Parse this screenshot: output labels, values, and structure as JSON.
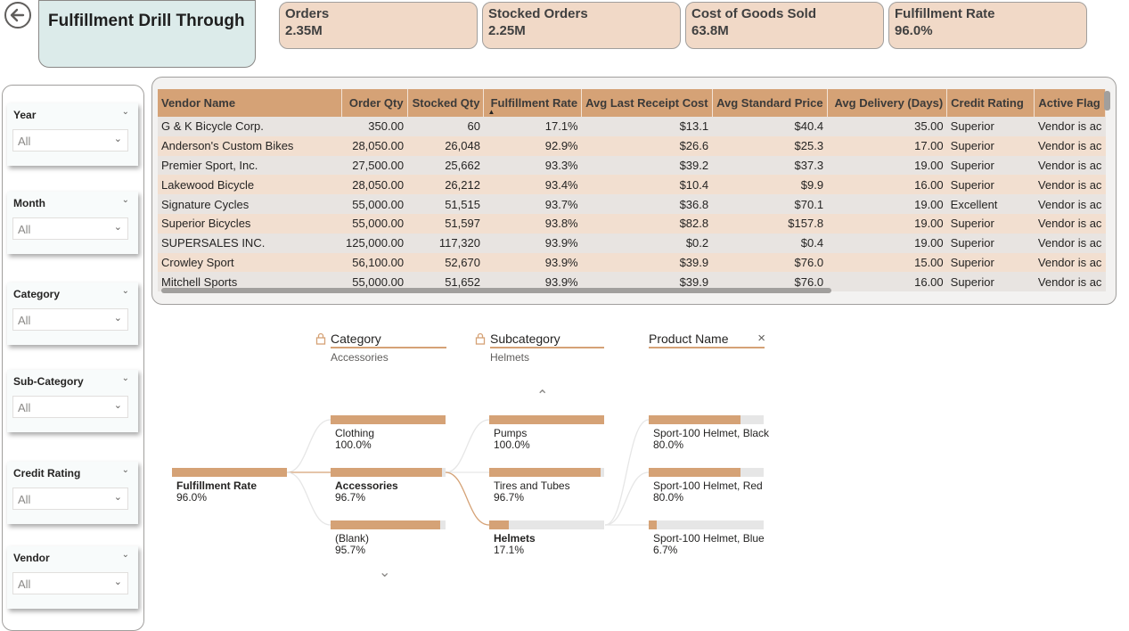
{
  "header": {
    "title": "Fulfillment Drill Through",
    "back_icon": "back-arrow-icon"
  },
  "kpis": [
    {
      "label": "Orders",
      "value": "2.35M"
    },
    {
      "label": "Stocked Orders",
      "value": "2.25M"
    },
    {
      "label": "Cost of Goods Sold",
      "value": "63.8M"
    },
    {
      "label": "Fulfillment Rate",
      "value": "96.0%"
    }
  ],
  "slicers": [
    {
      "title": "Year",
      "value": "All"
    },
    {
      "title": "Month",
      "value": "All"
    },
    {
      "title": "Category",
      "value": "All"
    },
    {
      "title": "Sub-Category",
      "value": "All"
    },
    {
      "title": "Credit Rating",
      "value": "All"
    },
    {
      "title": "Vendor",
      "value": "All"
    }
  ],
  "table": {
    "columns": [
      "Vendor Name",
      "Order Qty",
      "Stocked Qty",
      "Fulfillment Rate",
      "Avg Last Receipt Cost",
      "Avg Standard Price",
      "Avg Delivery (Days)",
      "Credit Rating",
      "Active Flag"
    ],
    "rows": [
      [
        "G & K Bicycle Corp.",
        "350.00",
        "60",
        "17.1%",
        "$13.1",
        "$40.4",
        "35.00",
        "Superior",
        "Vendor is ac"
      ],
      [
        "Anderson's Custom Bikes",
        "28,050.00",
        "26,048",
        "92.9%",
        "$26.6",
        "$25.3",
        "17.00",
        "Superior",
        "Vendor is ac"
      ],
      [
        "Premier Sport, Inc.",
        "27,500.00",
        "25,662",
        "93.3%",
        "$39.2",
        "$37.3",
        "19.00",
        "Superior",
        "Vendor is ac"
      ],
      [
        "Lakewood Bicycle",
        "28,050.00",
        "26,212",
        "93.4%",
        "$10.4",
        "$9.9",
        "16.00",
        "Superior",
        "Vendor is ac"
      ],
      [
        "Signature Cycles",
        "55,000.00",
        "51,515",
        "93.7%",
        "$36.8",
        "$70.1",
        "19.00",
        "Excellent",
        "Vendor is ac"
      ],
      [
        "Superior Bicycles",
        "55,000.00",
        "51,597",
        "93.8%",
        "$82.8",
        "$157.8",
        "19.00",
        "Superior",
        "Vendor is ac"
      ],
      [
        "SUPERSALES INC.",
        "125,000.00",
        "117,320",
        "93.9%",
        "$0.2",
        "$0.4",
        "19.00",
        "Superior",
        "Vendor is ac"
      ],
      [
        "Crowley Sport",
        "56,100.00",
        "52,670",
        "93.9%",
        "$39.9",
        "$76.0",
        "15.00",
        "Superior",
        "Vendor is ac"
      ],
      [
        "Mitchell Sports",
        "55,000.00",
        "51,652",
        "93.9%",
        "$39.9",
        "$76.0",
        "16.00",
        "Superior",
        "Vendor is ac"
      ]
    ],
    "sort_icon": "sort-ascending-icon"
  },
  "decomposition_tree": {
    "headers": [
      {
        "label": "Category",
        "sub": "Accessories",
        "icon": "lock-icon"
      },
      {
        "label": "Subcategory",
        "sub": "Helmets",
        "icon": "lock-icon"
      },
      {
        "label": "Product Name",
        "sub": "",
        "icon": "close-icon"
      }
    ],
    "root": {
      "name": "Fulfillment Rate",
      "value": "96.0%",
      "fraction": 1.0
    },
    "level1": [
      {
        "name": "Clothing",
        "value": "100.0%",
        "fraction": 1.0,
        "bold": false
      },
      {
        "name": "Accessories",
        "value": "96.7%",
        "fraction": 0.967,
        "bold": true
      },
      {
        "name": "(Blank)",
        "value": "95.7%",
        "fraction": 0.957,
        "bold": false
      }
    ],
    "level2": [
      {
        "name": "Pumps",
        "value": "100.0%",
        "fraction": 1.0,
        "bold": false
      },
      {
        "name": "Tires and Tubes",
        "value": "96.7%",
        "fraction": 0.967,
        "bold": false
      },
      {
        "name": "Helmets",
        "value": "17.1%",
        "fraction": 0.171,
        "bold": true
      }
    ],
    "level3": [
      {
        "name": "Sport-100 Helmet, Black",
        "value": "80.0%",
        "fraction": 0.8,
        "bold": false
      },
      {
        "name": "Sport-100 Helmet, Red",
        "value": "80.0%",
        "fraction": 0.8,
        "bold": false
      },
      {
        "name": "Sport-100 Helmet, Blue",
        "value": "6.7%",
        "fraction": 0.067,
        "bold": false
      }
    ],
    "scroll_up_icon": "chevron-up-icon",
    "scroll_down_icon": "chevron-down-icon"
  },
  "colors": {
    "accent": "#d5a276",
    "kpi_bg": "#f1d9c7",
    "title_bg": "#dcebea",
    "bar_empty": "#e6e6e6"
  }
}
